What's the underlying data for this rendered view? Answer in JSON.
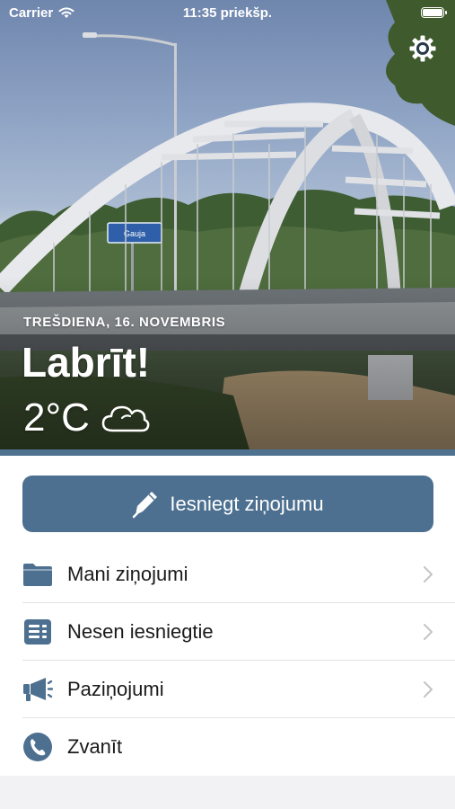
{
  "status_bar": {
    "carrier": "Carrier",
    "time": "11:35 priekšp.",
    "battery_level": 1.0
  },
  "hero": {
    "date": "TREŠDIENA, 16. NOVEMBRIS",
    "greeting": "Labrīt!",
    "temperature": "2°C",
    "weather_icon": "cloud-icon",
    "sign_text": "Gauja",
    "settings_icon": "gear-icon"
  },
  "actions": {
    "submit_report_label": "Iesniegt ziņojumu",
    "submit_report_icon": "pen-icon"
  },
  "menu": {
    "items": [
      {
        "label": "Mani ziņojumi",
        "icon": "folder-icon",
        "has_chevron": true
      },
      {
        "label": "Nesen iesniegtie",
        "icon": "list-icon",
        "has_chevron": true
      },
      {
        "label": "Paziņojumi",
        "icon": "megaphone-icon",
        "has_chevron": true
      },
      {
        "label": "Zvanīt",
        "icon": "phone-icon",
        "has_chevron": false
      }
    ]
  },
  "colors": {
    "accent": "#4d7090",
    "background": "#f2f2f4",
    "text": "#1a1a1a",
    "chevron": "#c4c4c7"
  }
}
